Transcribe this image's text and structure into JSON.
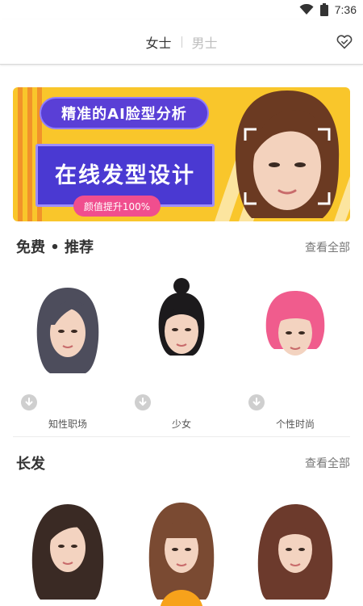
{
  "status_bar": {
    "time": "7:36",
    "wifi_icon": "wifi-icon",
    "battery_icon": "battery-icon"
  },
  "header": {
    "tabs": [
      {
        "label": "女士",
        "active": true
      },
      {
        "label": "男士",
        "active": false
      }
    ],
    "favorites_icon": "heart-check-icon"
  },
  "banner": {
    "title": "精准的AI脸型分析",
    "main": "在线发型设计",
    "sub": "颜值提升100%",
    "colors": {
      "background": "#f9c62b",
      "stripe": "#f08a2a",
      "pill": "#5a3fd6",
      "box": "#4a39d2",
      "pink": "#f04e8e"
    }
  },
  "sections": [
    {
      "title": "免费 • 推荐",
      "view_all": "查看全部",
      "items": [
        {
          "label": "知性职场",
          "hair_color": "#4d4d5c"
        },
        {
          "label": "少女",
          "hair_color": "#1c1a1c"
        },
        {
          "label": "个性时尚",
          "hair_color": "#f05c8d"
        }
      ]
    },
    {
      "title": "长发",
      "view_all": "查看全部",
      "items": [
        {
          "label": "",
          "hair_color": "#3a2a24"
        },
        {
          "label": "",
          "hair_color": "#7a4a32"
        },
        {
          "label": "",
          "hair_color": "#6c3a2c"
        }
      ]
    }
  ]
}
